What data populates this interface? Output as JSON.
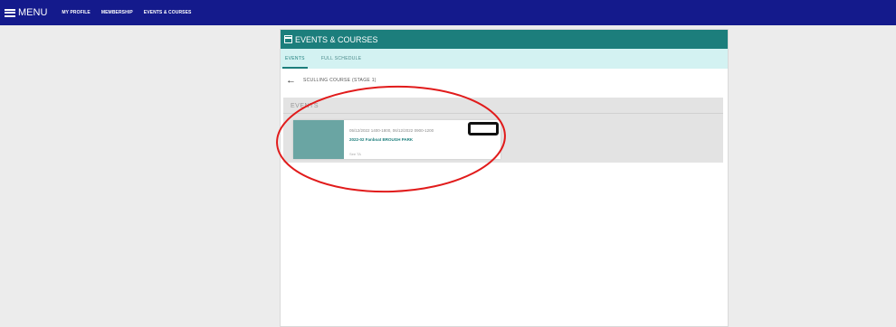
{
  "topbar": {
    "menu_label": "MENU",
    "nav": [
      "MY PROFILE",
      "MEMBERSHIP",
      "EVENTS & COURSES"
    ]
  },
  "panel": {
    "title": "EVENTS & COURSES",
    "tabs": [
      "EVENTS",
      "FULL SCHEDULE"
    ],
    "course_title": "SCULLING COURSE (STAGE 1)",
    "events_heading": "EVENTS",
    "event": {
      "dates": "05/12/2022 1400-1800, 06/12/2022 0900-1200",
      "name": "2022-02 Fanboat BROUGH PARK",
      "meta": "See TA"
    }
  },
  "colors": {
    "topbar": "#141a8c",
    "header": "#1c7e7c",
    "tab_bg": "#d3f2f2",
    "thumb": "#6aa5a3",
    "annotation": "#e11b1b"
  }
}
